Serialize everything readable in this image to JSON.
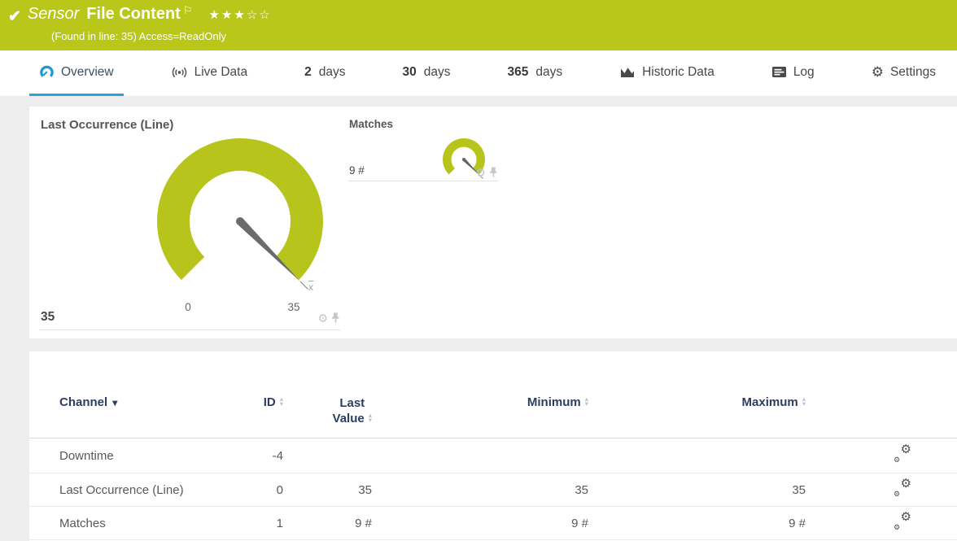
{
  "icons": {
    "check": "✔",
    "flag": "⚐",
    "gear": "⚙",
    "caret_down": "▾",
    "sort_up": "▴",
    "sort_down": "▾"
  },
  "header": {
    "type_label": "Sensor",
    "name": "File Content",
    "stars": "★★★☆☆",
    "status_line": "(Found in line: 35) Access=ReadOnly"
  },
  "tabs": {
    "overview": "Overview",
    "live_data": "Live Data",
    "d2_num": "2",
    "d2_unit": "days",
    "d30_num": "30",
    "d30_unit": "days",
    "d365_num": "365",
    "d365_unit": "days",
    "historic": "Historic Data",
    "log": "Log",
    "settings": "Settings"
  },
  "overview_panel": {
    "gauge_large": {
      "title": "Last Occurrence (Line)",
      "value_label": "35",
      "value": 35,
      "scale_min": "0",
      "scale_max": "35",
      "avg_marker": "x"
    },
    "gauge_small": {
      "title": "Matches",
      "value_label": "9 #",
      "value": 9,
      "unit": "#"
    }
  },
  "channels_table": {
    "headers": {
      "channel": "Channel",
      "id": "ID",
      "last_value_line1": "Last",
      "last_value_line2": "Value",
      "minimum": "Minimum",
      "maximum": "Maximum"
    },
    "rows": [
      {
        "channel": "Downtime",
        "id": "-4",
        "last_value": "",
        "minimum": "",
        "maximum": ""
      },
      {
        "channel": "Last Occurrence (Line)",
        "id": "0",
        "last_value": "35",
        "minimum": "35",
        "maximum": "35"
      },
      {
        "channel": "Matches",
        "id": "1",
        "last_value": "9 #",
        "minimum": "9 #",
        "maximum": "9 #"
      }
    ]
  },
  "colors": {
    "status_green": "#b8c719",
    "gauge_green": "#b7c41b",
    "accent_blue": "#2aa3da"
  }
}
